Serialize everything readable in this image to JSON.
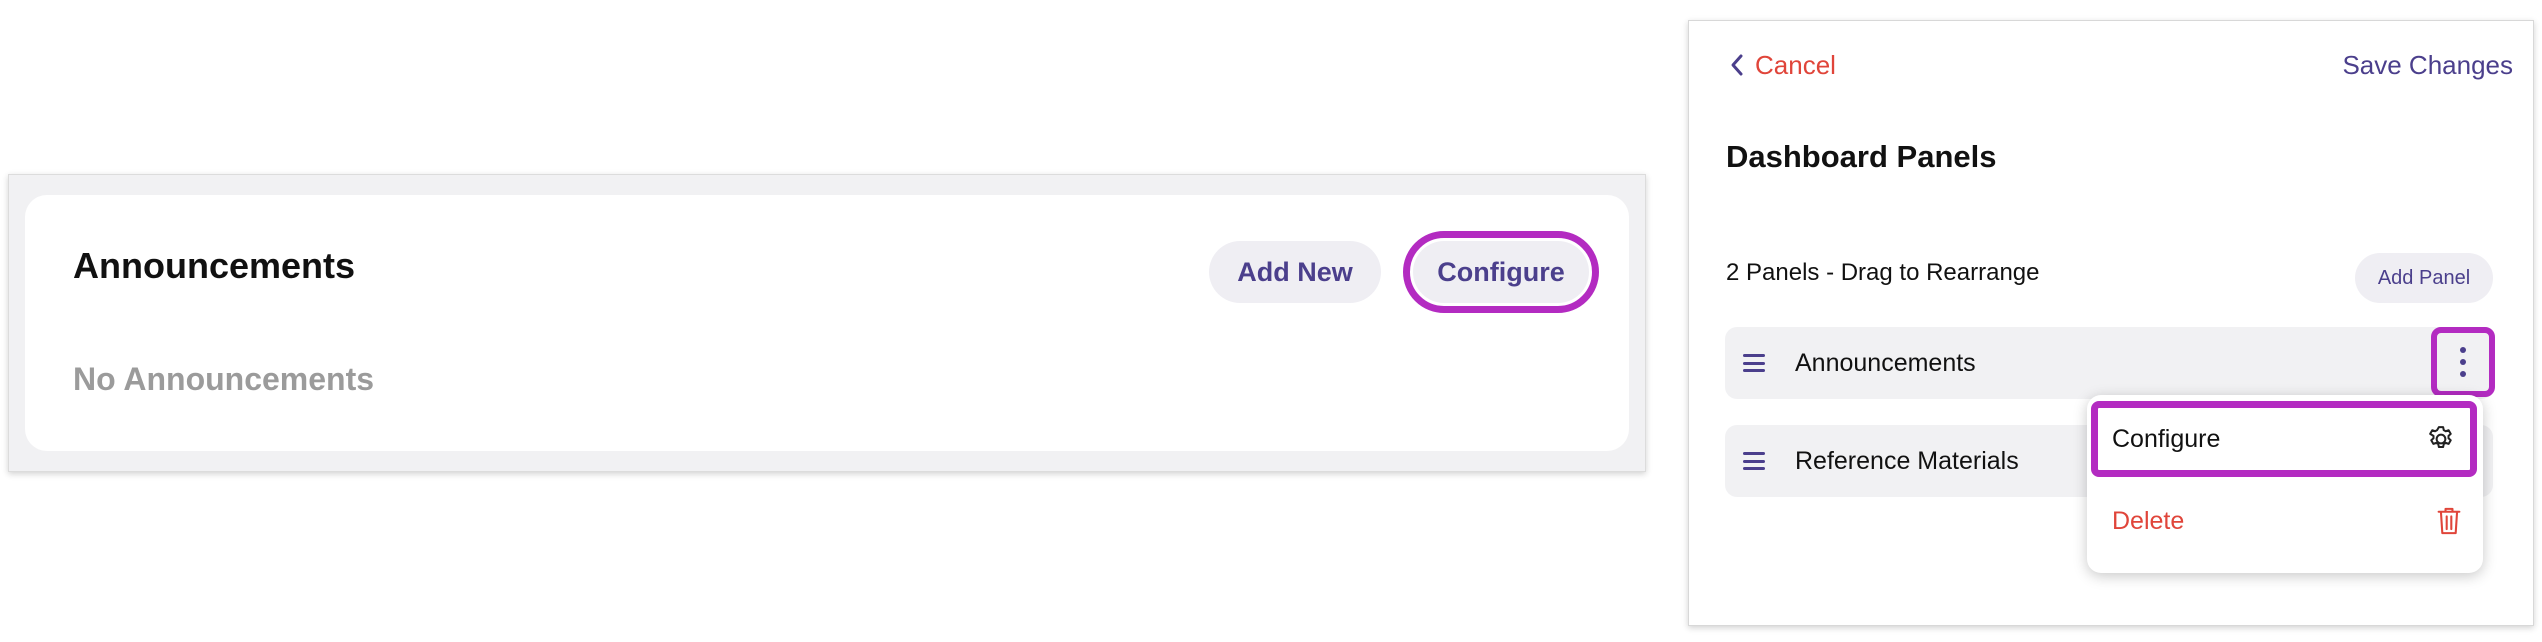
{
  "announcements_widget": {
    "title": "Announcements",
    "empty_message": "No Announcements",
    "add_new_label": "Add New",
    "configure_label": "Configure"
  },
  "dashboard_panels": {
    "cancel_label": "Cancel",
    "save_label": "Save Changes",
    "title": "Dashboard Panels",
    "subtitle": "2 Panels - Drag to Rearrange",
    "add_panel_label": "Add Panel",
    "panels": [
      {
        "label": "Announcements"
      },
      {
        "label": "Reference Materials"
      }
    ],
    "context_menu": {
      "configure_label": "Configure",
      "delete_label": "Delete"
    }
  },
  "colors": {
    "accent": "#4b3f8c",
    "highlight": "#b32bc1",
    "danger": "#e0453a",
    "pill_bg": "#efeef3"
  },
  "icons": {
    "cancel": "chevron-left-icon",
    "drag": "drag-handle-icon",
    "menu": "kebab-menu-icon",
    "configure": "gear-icon",
    "delete": "trash-icon"
  }
}
